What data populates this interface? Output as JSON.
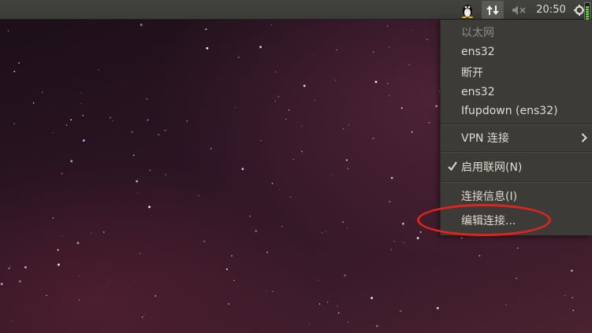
{
  "panel": {
    "clock": "20:50",
    "battery_level": 0.95
  },
  "icons": {
    "tux": "tux-icon",
    "network": "network-updown-icon",
    "volume": "volume-muted-icon",
    "gear": "gear-icon"
  },
  "menu": {
    "header_ethernet": "以太网",
    "device_1": "ens32",
    "disconnect": "断开",
    "device_2": "ens32",
    "ifupdown": "Ifupdown (ens32)",
    "vpn": "VPN 连接",
    "enable_networking": "启用联网(N)",
    "connection_info": "连接信息(I)",
    "edit_connections": "编辑连接..."
  },
  "colors": {
    "annotation_circle": "#e0241c",
    "menu_bg": "#3c3b37",
    "panel_bg": "#3c3b37"
  }
}
